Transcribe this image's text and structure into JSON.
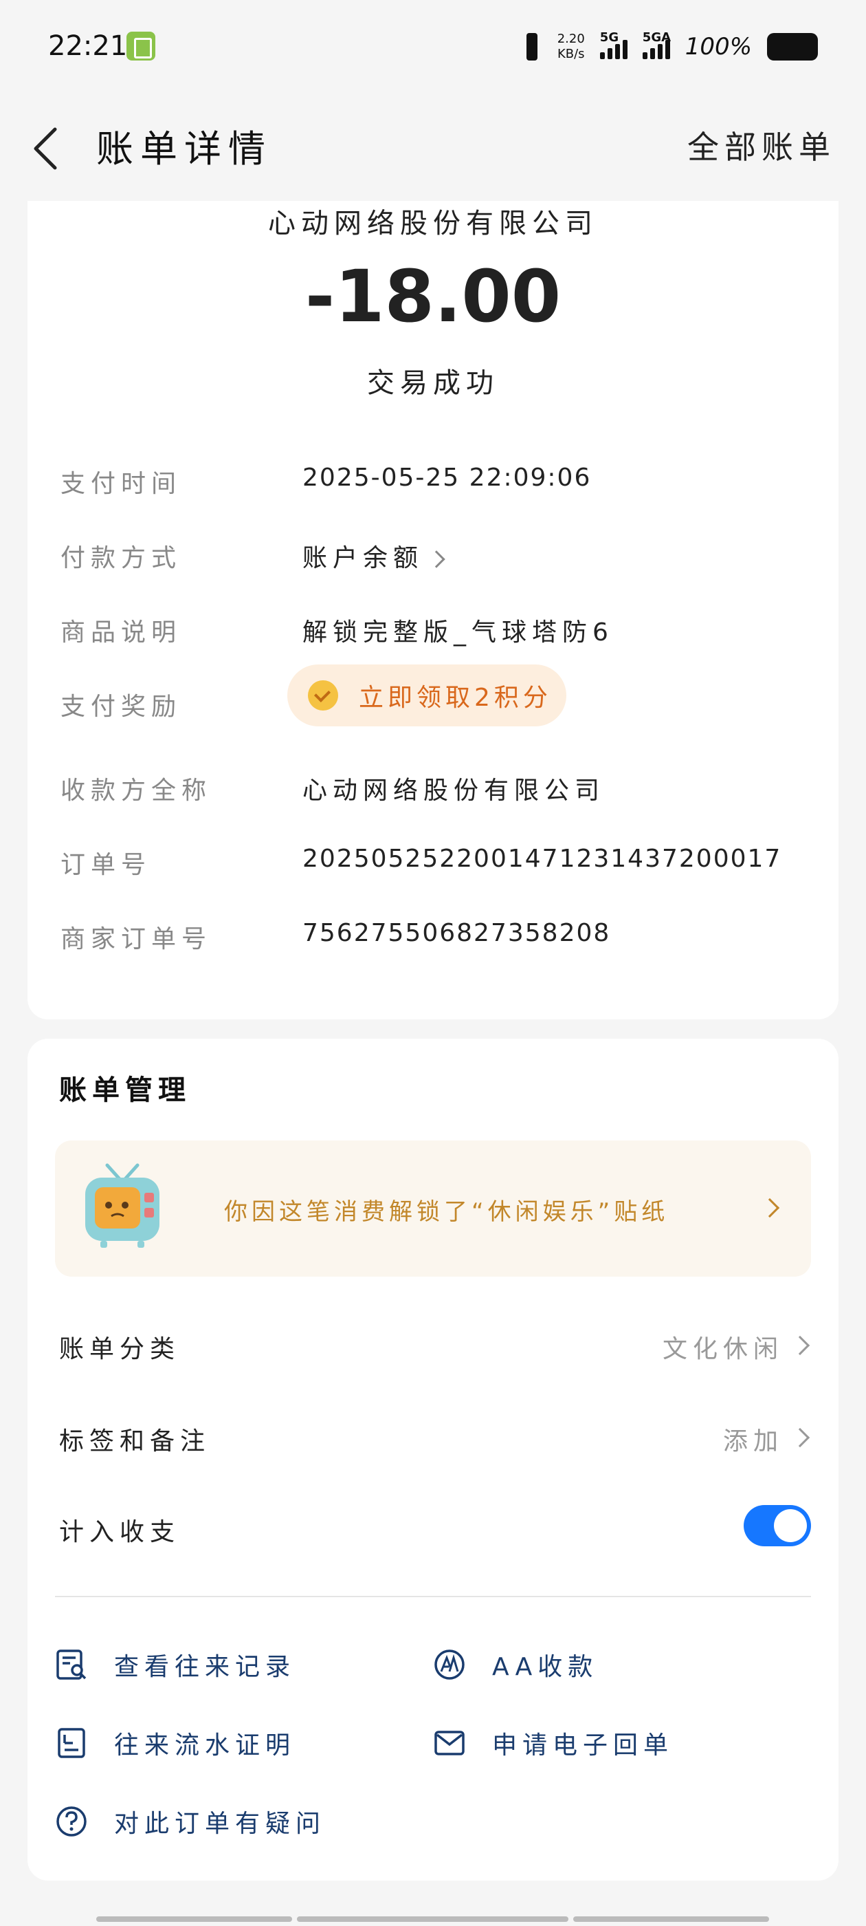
{
  "status_bar": {
    "time": "22:21",
    "net_speed_value": "2.20",
    "net_speed_unit": "KB/s",
    "sim1_label": "5G",
    "sim2_label": "5GA",
    "battery_percent": "100%"
  },
  "nav": {
    "title": "账单详情",
    "all_bills": "全部账单"
  },
  "transaction": {
    "payee": "心动网络股份有限公司",
    "amount": "-18.00",
    "status": "交易成功"
  },
  "details": [
    {
      "label": "支付时间",
      "value": "2025-05-25 22:09:06"
    },
    {
      "label": "付款方式",
      "value": "账户余额"
    },
    {
      "label": "商品说明",
      "value": "解锁完整版_气球塔防6"
    },
    {
      "label": "支付奖励",
      "value": "立即领取2积分"
    },
    {
      "label": "收款方全称",
      "value": "心动网络股份有限公司"
    },
    {
      "label": "订单号",
      "value": "2025052522001471231437200017"
    },
    {
      "label": "商家订单号",
      "value": "756275506827358208"
    }
  ],
  "management": {
    "title": "账单管理",
    "sticker_text": "你因这笔消费解锁了“休闲娱乐”贴纸",
    "category_label": "账单分类",
    "category_value": "文化休闲",
    "tags_label": "标签和备注",
    "tags_value": "添加",
    "include_label": "计入收支",
    "include_enabled": true
  },
  "actions": {
    "view_records": "查看往来记录",
    "aa_collect": "AA收款",
    "flow_proof": "往来流水证明",
    "e_receipt": "申请电子回单",
    "question": "对此订单有疑问"
  },
  "colors": {
    "accent_blue": "#1677ff",
    "action_text": "#1a3c6e",
    "reward_orange": "#d9681c",
    "sticker_gold": "#c2872a"
  }
}
